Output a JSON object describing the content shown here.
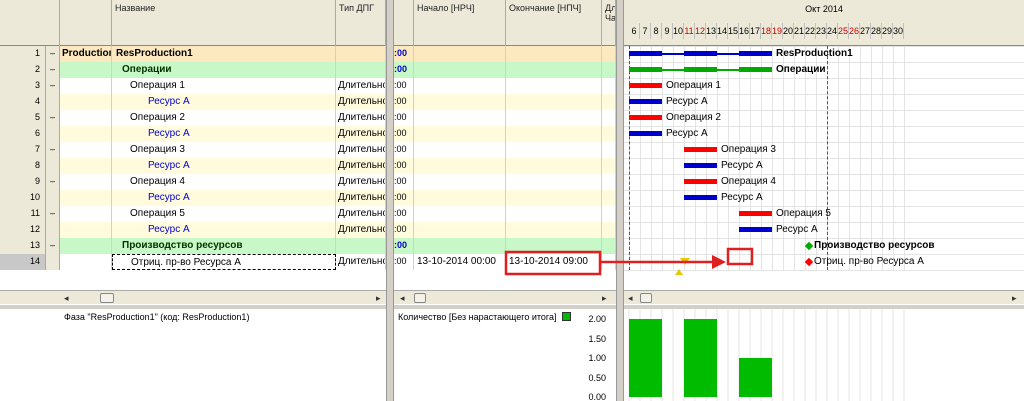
{
  "columns": {
    "name": "Название",
    "type": "Тип ДПГ",
    "start": "Начало [НРЧ]",
    "end": "Окончание [НПЧ]",
    "dur": "Дл Ча"
  },
  "rows": [
    {
      "num": "1",
      "exp": "–",
      "c0": "Production",
      "name": "ResProduction1",
      "type": "",
      "start": ":00",
      "end": "",
      "style": "prod"
    },
    {
      "num": "2",
      "exp": "–",
      "c0": "",
      "name": "Операции",
      "type": "",
      "start": ":00",
      "end": "",
      "style": "group"
    },
    {
      "num": "3",
      "exp": "–",
      "c0": "",
      "name": "Операция 1",
      "type": "Длительно",
      "start": ":00",
      "end": "",
      "style": "op"
    },
    {
      "num": "4",
      "exp": "",
      "c0": "",
      "name": "Ресурс А",
      "type": "Длительно",
      "start": ":00",
      "end": "",
      "style": "res"
    },
    {
      "num": "5",
      "exp": "–",
      "c0": "",
      "name": "Операция 2",
      "type": "Длительно",
      "start": ":00",
      "end": "",
      "style": "op"
    },
    {
      "num": "6",
      "exp": "",
      "c0": "",
      "name": "Ресурс А",
      "type": "Длительно",
      "start": ":00",
      "end": "",
      "style": "res"
    },
    {
      "num": "7",
      "exp": "–",
      "c0": "",
      "name": "Операция 3",
      "type": "Длительно",
      "start": ":00",
      "end": "",
      "style": "op"
    },
    {
      "num": "8",
      "exp": "",
      "c0": "",
      "name": "Ресурс А",
      "type": "Длительно",
      "start": ":00",
      "end": "",
      "style": "res"
    },
    {
      "num": "9",
      "exp": "–",
      "c0": "",
      "name": "Операция 4",
      "type": "Длительно",
      "start": ":00",
      "end": "",
      "style": "op"
    },
    {
      "num": "10",
      "exp": "",
      "c0": "",
      "name": "Ресурс А",
      "type": "Длительно",
      "start": ":00",
      "end": "",
      "style": "res"
    },
    {
      "num": "11",
      "exp": "–",
      "c0": "",
      "name": "Операция 5",
      "type": "Длительно",
      "start": ":00",
      "end": "",
      "style": "op"
    },
    {
      "num": "12",
      "exp": "",
      "c0": "",
      "name": "Ресурс А",
      "type": "Длительно",
      "start": ":00",
      "end": "",
      "style": "res"
    },
    {
      "num": "13",
      "exp": "–",
      "c0": "",
      "name": "Производство ресурсов",
      "type": "",
      "start": ":00",
      "end": "",
      "style": "group"
    },
    {
      "num": "14",
      "exp": "",
      "c0": "",
      "name": "Отриц. пр-во Ресурса А",
      "type": "Длительно",
      "start": ":00",
      "start2": "13-10-2014  00:00",
      "end": "13-10-2014  09:00",
      "style": "selected"
    }
  ],
  "gantt": {
    "month": "Окт 2014",
    "days": [
      "6",
      "7",
      "8",
      "9",
      "10",
      "11",
      "12",
      "13",
      "14",
      "15",
      "16",
      "17",
      "18",
      "19",
      "20",
      "21",
      "22",
      "23",
      "24",
      "25",
      "26",
      "27",
      "28",
      "29",
      "30"
    ],
    "weekend": [
      "11",
      "12",
      "18",
      "19",
      "25",
      "26"
    ],
    "labels": {
      "r1": "ResProduction1",
      "r2": "Операции",
      "r3": "Операция 1",
      "r4": "Ресурс А",
      "r5": "Операция 2",
      "r6": "Ресурс А",
      "r7": "Операция 3",
      "r8": "Ресурс А",
      "r9": "Операция 4",
      "r10": "Ресурс А",
      "r11": "Операция 5",
      "r12": "Ресурс А",
      "r13": "Производство ресурсов",
      "r14": "Отриц. пр-во Ресурса А"
    },
    "colors": {
      "red": "#ff0000",
      "blue": "#0000cc",
      "green": "#00aa00",
      "annotation": "#e02020"
    }
  },
  "bottom": {
    "phase_caption": "Фаза \"ResProduction1\" (код: ResProduction1)",
    "legend": "Количество [Без нарастающего итога]"
  },
  "chart_data": {
    "type": "bar",
    "title": "",
    "ylabel": "",
    "ylim": [
      0,
      2
    ],
    "yticks": [
      "2.00",
      "1.50",
      "1.00",
      "0.50",
      "0.00"
    ],
    "bars": [
      {
        "start_day": 6,
        "end_day": 12,
        "value": 2.0
      },
      {
        "start_day": 16,
        "end_day": 22,
        "value": 2.0
      },
      {
        "start_day": 26,
        "end_day": 32,
        "value": 1.0
      }
    ],
    "color": "#00bb00"
  }
}
